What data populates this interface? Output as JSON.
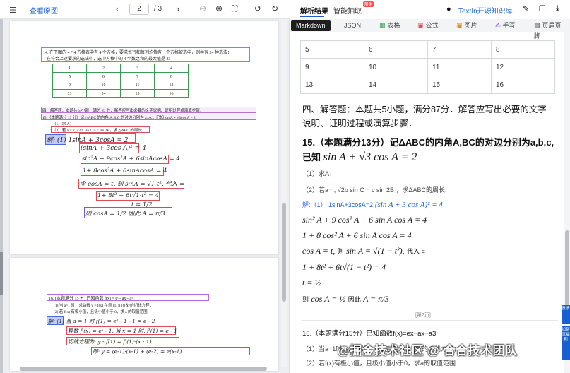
{
  "left_toolbar": {
    "menu_icon": "menu-icon",
    "view_original": "查看原图",
    "page_current": "2",
    "page_separator": "/ 3",
    "prev_icon": "chevron-left-icon",
    "next_icon": "chevron-right-icon",
    "zoom_out_icon": "zoom-out-icon",
    "zoom_in_icon": "zoom-in-icon",
    "fit_icon": "fit-icon",
    "rotate_left_icon": "rotate-left-icon",
    "rotate_right_icon": "rotate-right-icon"
  },
  "pdf": {
    "q14_text": "14. 在下图的 4 * 4 方格表中有 4 个方格，要求每行和每列均恰有一个方格被选中，则共有  24  种选法；",
    "q14_text2": "在符合上述要求的选法中，选中方格中的 4 个数之和的最大值是  33  .",
    "grid": [
      [
        "1",
        "2",
        "3",
        "4"
      ],
      [
        "5",
        "6",
        "7",
        "8"
      ],
      [
        "9",
        "10",
        "11",
        "12"
      ],
      [
        "13",
        "14",
        "15",
        "16"
      ]
    ],
    "section4": "四、解答题：本题共 5 小题，满分 87 分．解答应写出必要的文字说明、证明过程或演算步骤．",
    "q15_head": "15.（本题满分 13 分）记 △ABC 的内角 A,B,C 的对边分别为 a,b,c，已知 sin A + √3cos A = 2",
    "q15_sub1": "（1）求 A；",
    "q15_sub2": "（2）若 a = 2, √2 b sin C = c sin 2B，求 △ABC 的周长.",
    "hw_lines": [
      "解: (1) 1sinA + 3cosA = 2",
      "(sinA + 3cos A)² = 4",
      "sin²A + 9cos²A + 6sinAcosA = 4",
      "1+ 8cos²A + 6sinAcosA = 4",
      "令 cosA = t, 则 sinA = √1-t², 代入 =",
      "1+ 8t² + 6t√1-t² = 4",
      "t = 1/2",
      "则 cosA = 1/2  因此 A = π/3"
    ],
    "q16_head": "16. (本题满分 15 分) 已知函数 f(x) = eˣ - ax - a³.",
    "q16_sub1": "(1) 当 a=1 时，求曲线 y = f(x) 在点 (1, f(1)) 处的切线方程；",
    "q16_sub2": "(2) 若 f(x) 有极小值，且极小值小于 0，求 a 的取值范围.",
    "hw16": [
      "解: (1) 当 a = 1 时   f(1) = e¹ - 1 - 1 = e - 2",
      "导数 f'(x) = eˣ - 1, 当 x = 1 时, f'(1) = e - 1",
      "切线方程为:   y - f(1) = f'(1)·(x - 1)",
      "即:  y = (e-1)·(x-1) + (e-2) = e(x-1)"
    ]
  },
  "right_top": {
    "tab_result": "解析结果",
    "tab_extract": "智能抽取",
    "badge": "限免",
    "github_icon": "github-icon",
    "kb_link": "TextIn开源知识库",
    "edit_icon": "edit-icon",
    "copy_icon": "copy-icon",
    "download_icon": "download-icon"
  },
  "format_tabs": [
    {
      "label": "Markdown",
      "icon": ""
    },
    {
      "label": "JSON",
      "icon": ""
    },
    {
      "label": "表格",
      "icon": "table-icon"
    },
    {
      "label": "公式",
      "icon": "formula-icon"
    },
    {
      "label": "图片",
      "icon": "image-icon"
    },
    {
      "label": "手写",
      "icon": "handwriting-icon"
    },
    {
      "label": "页眉页脚",
      "icon": "header-footer-icon"
    }
  ],
  "result": {
    "table": [
      [
        "5",
        "6",
        "7",
        "8"
      ],
      [
        "9",
        "10",
        "11",
        "12"
      ],
      [
        "13",
        "14",
        "15",
        "16"
      ]
    ],
    "section4": "四、解答题：本题共5小题，满分87分．解答应写出必要的文字",
    "section4b": "说明、证明过程或演算步骤．",
    "q15_a": "15.（本题满分13分）记ΔABC的内角A,BC的对边分别为a,b,c,",
    "q15_b_pre": "已知",
    "q15_b_math": "sin A + √3 cos A = 2",
    "q15_1": "（1）求A；",
    "q15_2": "（2）若a= , √2b sin C = c sin 2B ，求ΔABC的周长.",
    "sol_label": "解:（1）  1sinA+3cosA=2",
    "sol_math": "(sin A + 3 cos A)² = 4",
    "eq1": "sin² A + 9 cos² A + 6 sin A cos A = 4",
    "eq2": "1 + 8 cos² A + 6 sin A cos A = 4",
    "eq3a": "cos A = t,",
    "eq3b": "则",
    "eq3c": "sin A = √(1 − t²),",
    "eq3d": "代入 =",
    "eq4": "1 + 8t² + 6t√(1 − t²) = 4",
    "eq5": "t = ½",
    "eq6a": "则",
    "eq6b": "cos A = ½",
    "eq6c": "因此",
    "eq6d": "A = π/3",
    "page_footer": "[第2页]",
    "q16": "16.（本题满分15分）已知函数f(x)=ex−ax−a3",
    "q16_1": "（1）当a=1时，求曲线y=f(x)在点(1,f(1))处的切线方程；",
    "q16_2": "（2）若f(x)有极小值，且极小值小于0，求a的取值范围."
  },
  "side_buttons": [
    "反馈",
    "加群享福利"
  ],
  "watermark": "@掘金技术社区 @ 合合技术团队"
}
